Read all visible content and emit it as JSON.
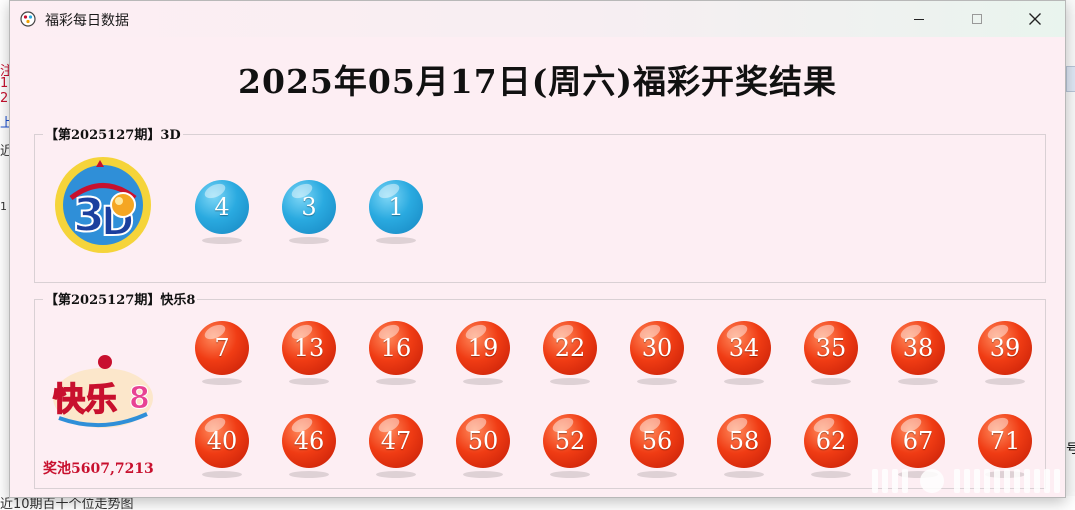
{
  "window": {
    "title": "福彩每日数据",
    "minimize_icon": "minimize-icon",
    "maximize_icon": "maximize-icon",
    "close_icon": "close-icon"
  },
  "headline": "2025年05月17日(周六)福彩开奖结果",
  "lottery_3d": {
    "legend": "【第2025127期】3D",
    "logo_icon": "3d-logo-icon",
    "numbers": [
      "4",
      "3",
      "1"
    ],
    "ball_color": "#2aaae0"
  },
  "lottery_kl8": {
    "legend": "【第2025127期】快乐8",
    "logo_icon": "kuaile8-logo-icon",
    "numbers_row1": [
      "7",
      "13",
      "16",
      "19",
      "22",
      "30",
      "34",
      "35",
      "38",
      "39"
    ],
    "numbers_row2": [
      "40",
      "46",
      "47",
      "50",
      "52",
      "56",
      "58",
      "62",
      "67",
      "71"
    ],
    "ball_color": "#f03c14",
    "pool": "奖池5607,7213"
  },
  "background": {
    "left_fragments": [
      "注",
      "1.",
      "2.",
      "上",
      "近",
      "1"
    ],
    "bottom_fragment": "近10期百十个位走势图",
    "right_fragment": "号"
  },
  "colors": {
    "window_bg": "#fdeef3",
    "pool_text": "#c8102e"
  }
}
